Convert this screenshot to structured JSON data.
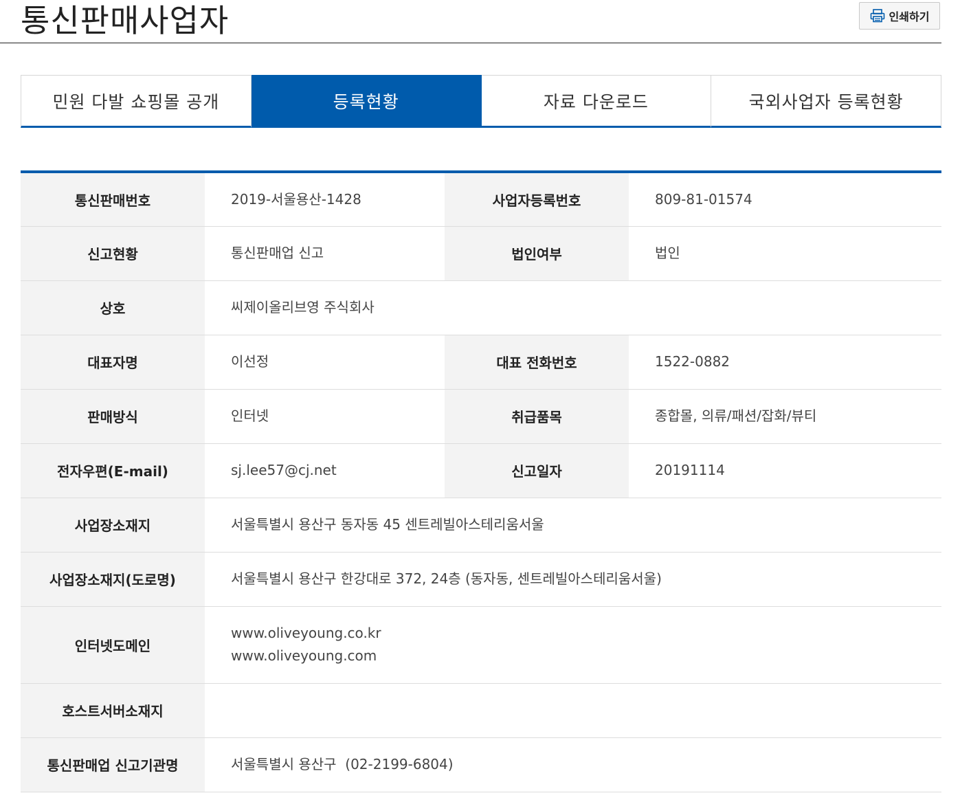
{
  "page_title": "통신판매사업자",
  "print_button": {
    "label": "인쇄하기",
    "icon": "printer-icon"
  },
  "tabs": [
    {
      "label": "민원 다발 쇼핑몰 공개",
      "active": false
    },
    {
      "label": "등록현황",
      "active": true
    },
    {
      "label": "자료 다운로드",
      "active": false
    },
    {
      "label": "국외사업자 등록현황",
      "active": false
    }
  ],
  "colors": {
    "accent": "#005bac",
    "header_bg": "#f3f3f3",
    "border": "#dddddd"
  },
  "info": {
    "report_no_label": "통신판매번호",
    "report_no": "2019-서울용산-1428",
    "biz_reg_no_label": "사업자등록번호",
    "biz_reg_no": "809-81-01574",
    "report_status_label": "신고현황",
    "report_status": "통신판매업 신고",
    "corporation_label": "법인여부",
    "corporation": "법인",
    "company_name_label": "상호",
    "company_name": "씨제이올리브영 주식회사",
    "ceo_label": "대표자명",
    "ceo": "이선정",
    "phone_label": "대표 전화번호",
    "phone": "1522-0882",
    "sales_method_label": "판매방식",
    "sales_method": "인터넷",
    "items_label": "취급품목",
    "items": "종합몰, 의류/패션/잡화/뷰티",
    "email_label": "전자우편(E-mail)",
    "email": "sj.lee57@cj.net",
    "report_date_label": "신고일자",
    "report_date": "20191114",
    "address_label": "사업장소재지",
    "address": "서울특별시 용산구 동자동 45 센트레빌아스테리움서울",
    "road_address_label": "사업장소재지(도로명)",
    "road_address": "서울특별시 용산구 한강대로 372, 24층 (동자동, 센트레빌아스테리움서울)",
    "domain_label": "인터넷도메인",
    "domains": [
      "www.oliveyoung.co.kr",
      "www.oliveyoung.com"
    ],
    "host_server_label": "호스트서버소재지",
    "host_server": "",
    "agency_label": "통신판매업 신고기관명",
    "agency": "서울특별시 용산구  (02-2199-6804)"
  }
}
